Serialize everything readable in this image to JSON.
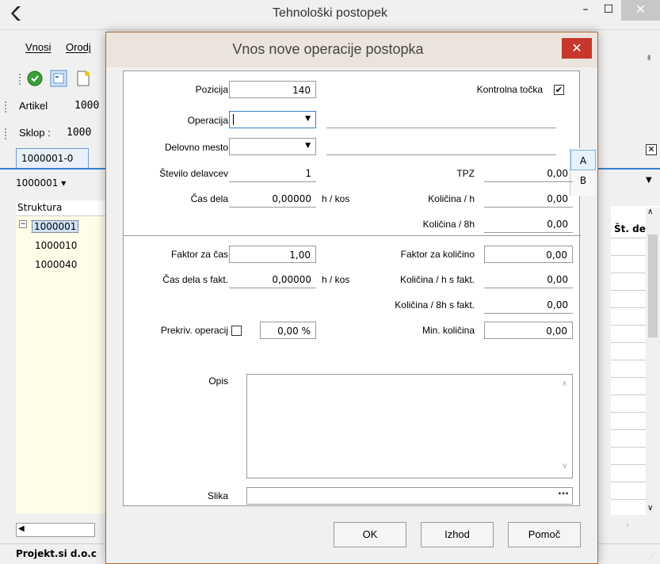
{
  "window": {
    "title": "Tehnološki postopek",
    "minimize_label": "–",
    "maximize_label": "☐",
    "close_label": "✕"
  },
  "menu": {
    "items": [
      "Vnosi",
      "Orodj"
    ]
  },
  "main": {
    "artikel_label": "Artikel",
    "artikel_value": "1000",
    "sklop_label": "Sklop :",
    "sklop_value": "1000",
    "tab_label": "1000001-0",
    "combo_value": "1000001 ▾",
    "tree_header": "Struktura",
    "tree_root": "1000001",
    "tree_children": [
      "1000010",
      "1000040"
    ],
    "grid_header": "Št. de",
    "status_text": "Projekt.si d.o.c"
  },
  "dialog": {
    "title": "Vnos nove operacije postopka",
    "close_label": "✕",
    "fields": {
      "pozicija_label": "Pozicija",
      "pozicija_value": "140",
      "kontrolna_label": "Kontrolna točka",
      "kontrolna_checked": "✔",
      "operacija_label": "Operacija",
      "delovno_mesto_label": "Delovno mesto",
      "stevilo_delavcev_label": "Število delavcev",
      "stevilo_delavcev_value": "1",
      "tpz_label": "TPZ",
      "tpz_value": "0,00",
      "cas_dela_label": "Čas dela",
      "cas_dela_value": "0,00000",
      "cas_dela_unit": "h / kos",
      "kolicina_h_label": "Količina / h",
      "kolicina_h_value": "0,00",
      "kolicina_8h_label": "Količina / 8h",
      "kolicina_8h_value": "0,00",
      "faktor_cas_label": "Faktor za čas",
      "faktor_cas_value": "1,00",
      "faktor_kolicino_label": "Faktor za količino",
      "faktor_kolicino_value": "0,00",
      "cas_dela_fakt_label": "Čas dela s fakt.",
      "cas_dela_fakt_value": "0,00000",
      "cas_dela_fakt_unit": "h / kos",
      "kolicina_h_fakt_label": "Količina / h s fakt.",
      "kolicina_h_fakt_value": "0,00",
      "kolicina_8h_fakt_label": "Količina / 8h s fakt.",
      "kolicina_8h_fakt_value": "0,00",
      "prekriv_label": "Prekriv. operacij",
      "prekriv_value": "0,00 %",
      "min_kolicina_label": "Min. količina",
      "min_kolicina_value": "0,00",
      "opis_label": "Opis",
      "slika_label": "Slika",
      "slika_button": "···"
    },
    "side_list": [
      "A",
      "B"
    ],
    "buttons": {
      "ok": "OK",
      "izhod": "Izhod",
      "pomoc": "Pomoč"
    }
  }
}
